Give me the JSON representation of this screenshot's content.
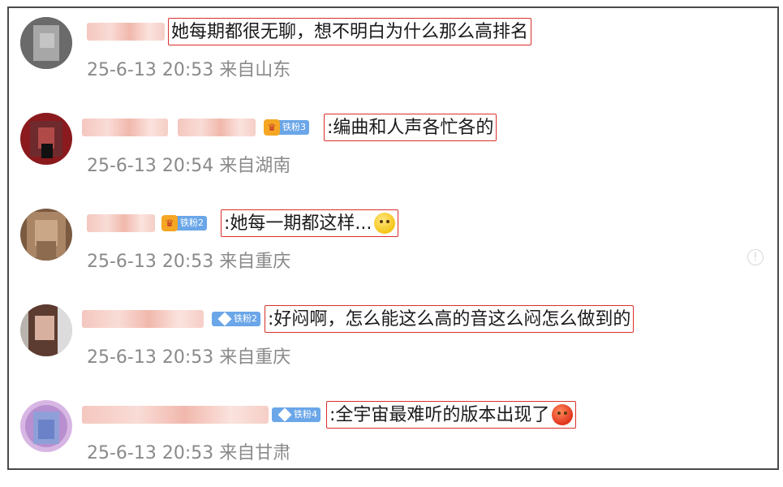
{
  "comments": [
    {
      "text": "她每期都很无聊，想不明白为什么那么高排名",
      "badge": null,
      "emoji": null,
      "time": "25-6-13 20:53",
      "location": "来自山东"
    },
    {
      "text": ":编曲和人声各忙各的",
      "badge": {
        "label": "铁粉3",
        "icon": "crown-icon"
      },
      "emoji": null,
      "time": "25-6-13 20:54",
      "location": "来自湖南"
    },
    {
      "text": ":她每一期都这样...",
      "badge": {
        "label": "铁粉2",
        "icon": "crown-icon"
      },
      "emoji": "thinking-emoji",
      "time": "25-6-13 20:53",
      "location": "来自重庆"
    },
    {
      "text": ":好闷啊，怎么能这么高的音这么闷怎么做到的",
      "badge": {
        "label": "铁粉2",
        "icon": "diamond-icon"
      },
      "emoji": null,
      "time": "25-6-13 20:53",
      "location": "来自重庆"
    },
    {
      "text": ":全宇宙最难听的版本出现了",
      "badge": {
        "label": "铁粉4",
        "icon": "diamond-icon"
      },
      "emoji": "angry-emoji",
      "time": "25-6-13 20:53",
      "location": "来自甘肃"
    }
  ],
  "colors": {
    "highlight_border": "#d9302b",
    "meta_text": "#8a8a8a",
    "badge_blue": "#6aa6e8",
    "frame_border": "#4a4a4a"
  },
  "icons": {
    "report": "exclamation-circle-icon"
  }
}
